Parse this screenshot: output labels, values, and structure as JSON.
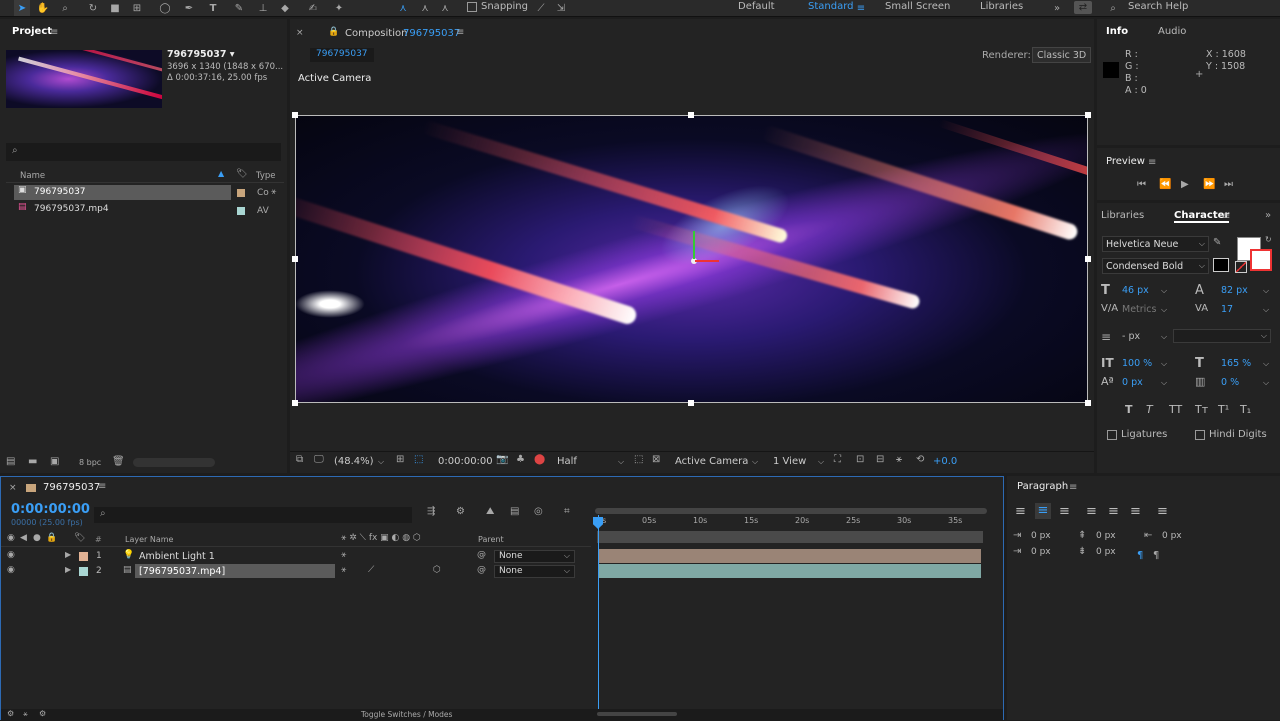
{
  "toolbar": {
    "snapping": "Snapping",
    "workspaces": [
      "Default",
      "Standard",
      "Small Screen",
      "Libraries"
    ],
    "search_placeholder": "Search Help"
  },
  "project": {
    "title": "Project",
    "comp_name": "796795037 ▾",
    "comp_dims": "3696 x 1340  (1848 x 670...",
    "comp_duration": "Δ 0:00:37:16, 25.00 fps",
    "col_name": "Name",
    "col_type": "Type",
    "items": [
      {
        "name": "796795037",
        "type": "Co"
      },
      {
        "name": "796795037.mp4",
        "type": "AV"
      }
    ],
    "bpc": "8 bpc"
  },
  "comp": {
    "prefix": "Composition",
    "name": "796795037",
    "tab": "796795037",
    "renderer_label": "Renderer:",
    "renderer": "Classic 3D",
    "active_camera": "Active Camera",
    "zoom": "(48.4%)",
    "timecode": "0:00:00:00",
    "resolution": "Half",
    "view_camera": "Active Camera",
    "views": "1 View",
    "exposure": "+0.0"
  },
  "info": {
    "tab_info": "Info",
    "tab_audio": "Audio",
    "r": "R :",
    "g": "G :",
    "b": "B :",
    "a": "A : 0",
    "x": "X : 1608",
    "y": "Y : 1508"
  },
  "preview": {
    "title": "Preview"
  },
  "character": {
    "tab_libraries": "Libraries",
    "tab_character": "Character",
    "font": "Helvetica Neue",
    "style": "Condensed Bold",
    "size": "46 px",
    "leading": "82 px",
    "kerning": "Metrics",
    "tracking": "17",
    "stroke": "- px",
    "vscale": "100 %",
    "hscale": "165 %",
    "baseline": "0 px",
    "tsume": "0 %",
    "ligatures": "Ligatures",
    "hindi_digits": "Hindi Digits"
  },
  "paragraph": {
    "title": "Paragraph",
    "indent_left": "0 px",
    "space_before": "0 px",
    "indent_first": "0 px",
    "space_after": "0 px",
    "indent_right": "0 px"
  },
  "timeline": {
    "tab": "796795037",
    "timecode": "0:00:00:00",
    "frames": "00000 (25.00 fps)",
    "col_layer": "Layer Name",
    "col_parent": "Parent",
    "layers": [
      {
        "num": "1",
        "name": "Ambient Light 1",
        "parent": "None",
        "color": "#e2b294"
      },
      {
        "num": "2",
        "name": "[796795037.mp4]",
        "parent": "None",
        "color": "#a9d6d2"
      }
    ],
    "ruler": [
      "0s",
      "05s",
      "10s",
      "15s",
      "20s",
      "25s",
      "30s",
      "35s"
    ],
    "toggle": "Toggle Switches / Modes"
  }
}
